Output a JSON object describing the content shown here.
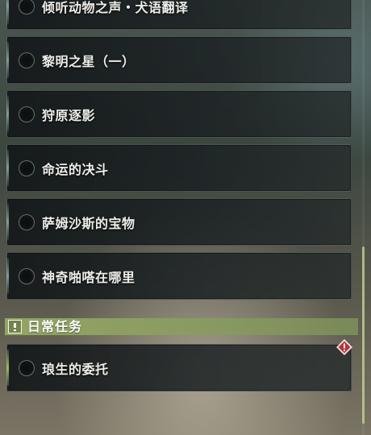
{
  "quests": [
    {
      "title": "倾听动物之声・犬语翻译"
    },
    {
      "title": "黎明之星（一）"
    },
    {
      "title": "狩原逐影"
    },
    {
      "title": "命运的决斗"
    },
    {
      "title": "萨姆沙斯的宝物"
    },
    {
      "title": "神奇啪嗒在哪里"
    }
  ],
  "daily_section": {
    "title": "日常任务",
    "icon": "exclamation-icon"
  },
  "daily_quests": [
    {
      "title": "琅生的委托",
      "badge": "alert-diamond-icon"
    }
  ],
  "colors": {
    "section_header": "#96aa64",
    "daily_accent": "#aabe6e",
    "alert_badge": "#b8323a"
  }
}
